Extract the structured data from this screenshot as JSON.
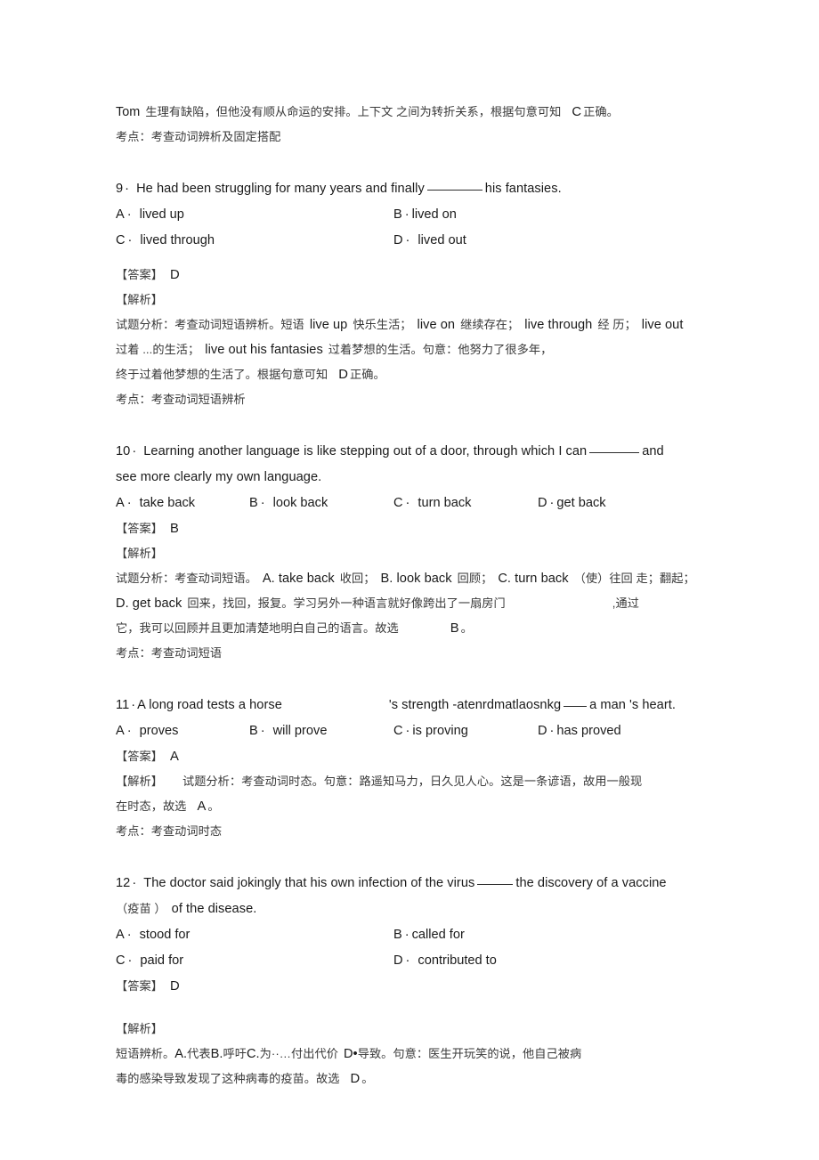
{
  "document": {
    "type": "exam-answer-key",
    "language": "zh-CN/en",
    "page_background": "#ffffff",
    "text_color": "#231f20"
  },
  "top_fragment": {
    "analysis_line": "Tom 生理有缺陷，但他没有顺从命运的安排。上下文 之间为转折关系，根据句意可知 C 正确。",
    "analysis_prefix": "Tom",
    "analysis_body_1": "生理有缺陷，但他没有顺从命运的安排。上下文 之间为转折关系，根据句意可知",
    "analysis_answer": "C",
    "analysis_body_2": "正确。",
    "point_label": "考点：考查动词辨析及固定搭配"
  },
  "questions": [
    {
      "number": "9",
      "separator": "·",
      "stem_lines": [
        "He had been struggling for many years and finally",
        "his fantasies."
      ],
      "stem_before_blank": "He had been struggling for many years and finally",
      "stem_after_blank": "his fantasies.",
      "blank_width": "long",
      "options_layout": "2-column",
      "options": [
        {
          "label": "A",
          "sep": "·",
          "text": "lived up"
        },
        {
          "label": "B",
          "sep": "·",
          "text": "lived on"
        },
        {
          "label": "C",
          "sep": "·",
          "text": "lived through"
        },
        {
          "label": "D",
          "sep": "·",
          "text": "lived out"
        }
      ],
      "answer_label": "【答案】",
      "answer": "D",
      "explain_label": "【解析】",
      "explain_lines": [
        "试题分析：考查动词短语辨析。短语 live up 快乐生活； live on 继续存在； live through 经 历； live out",
        "过着 ...的生活； live out his fantasies 过着梦想的生活。句意：他努力了很多年，",
        "终于过着他梦想的生活了。根据句意可知 D 正确。"
      ],
      "explain_seg": {
        "l1_a": "试题分析：考查动词短语辨析。短语",
        "l1_b": "live up",
        "l1_c": "快乐生活；",
        "l1_d": "live on",
        "l1_e": "继续存在；",
        "l1_f": "live through",
        "l1_g": "经 历；",
        "l1_h": "live out",
        "l2_a": "过着 ...的生活；",
        "l2_b": "live out his fantasies",
        "l2_c": "过着梦想的生活。句意：他努力了很多年，",
        "l3_a": "终于过着他梦想的生活了。根据句意可知",
        "l3_b": "D",
        "l3_c": "正确。"
      },
      "point_label": "考点：考查动词短语辨析"
    },
    {
      "number": "10",
      "separator": "·",
      "stem_before_blank": "Learning another language is like stepping out of a door, through which I can",
      "stem_after_blank": "and",
      "stem_line2": "see more clearly my own language.",
      "blank_width": "mid",
      "options_layout": "4-column",
      "options": [
        {
          "label": "A",
          "sep": "·",
          "text": "take back"
        },
        {
          "label": "B",
          "sep": "·",
          "text": "look back"
        },
        {
          "label": "C",
          "sep": "·",
          "text": "turn back"
        },
        {
          "label": "D",
          "sep": "·",
          "text": "get back"
        }
      ],
      "answer_label": "【答案】",
      "answer": "B",
      "explain_label": "【解析】",
      "explain_seg": {
        "l1_a": "试题分析：考查动词短语。",
        "l1_b": "A. take back",
        "l1_c": "收回；",
        "l1_d": "B. look back",
        "l1_e": "回顾；",
        "l1_f": "C. turn back",
        "l1_g": "（使）往回 走；翻起；",
        "l2_a": "D. get back",
        "l2_b": "回来，找回，报复。学习另外一种语言就好像跨出了一扇房门",
        "l2_c": ",通过",
        "l3_a": "它，我可以回顾并且更加清楚地明白自己的语言。故选",
        "l3_b": "B",
        "l3_c": "。"
      },
      "point_label": "考点：考查动词短语"
    },
    {
      "number": "11",
      "separator": "·",
      "stem_a": "A long road tests a horse",
      "stem_b": "'s strength -atenrdmatlaosnkg",
      "stem_c": "a man 's heart.",
      "blank_width": "tiny",
      "options_layout": "4-column",
      "options": [
        {
          "label": "A",
          "sep": "·",
          "text": "proves"
        },
        {
          "label": "B",
          "sep": "·",
          "text": "will prove"
        },
        {
          "label": "C",
          "sep": "·",
          "text": "is proving"
        },
        {
          "label": "D",
          "sep": "·",
          "text": "has proved"
        }
      ],
      "answer_label": "【答案】",
      "answer": "A",
      "explain_label": "【解析】",
      "explain_seg": {
        "l1_a": "试题分析：考查动词时态。句意：路遥知马力，日久见人心。这是一条谚语，故用一般现",
        "l2_a": "在时态，故选",
        "l2_b": "A",
        "l2_c": "。"
      },
      "point_label": "考点：考查动词时态"
    },
    {
      "number": "12",
      "separator": "·",
      "stem_before_blank": "The doctor said jokingly that his own infection of the virus",
      "stem_after_blank": "the discovery of a vaccine",
      "stem_line2_cn": "（疫苗 ）",
      "stem_line2_en": "of the disease.",
      "blank_width": "short",
      "options_layout": "2-column",
      "options": [
        {
          "label": "A",
          "sep": "·",
          "text": "stood for"
        },
        {
          "label": "B",
          "sep": "·",
          "text": "called for"
        },
        {
          "label": "C",
          "sep": "·",
          "text": "paid for"
        },
        {
          "label": "D",
          "sep": "·",
          "text": "contributed to"
        }
      ],
      "answer_label": "【答案】",
      "answer": "D",
      "explain_label": "【解析】",
      "explain_seg": {
        "l1_a": "短语辨析。",
        "l1_b": "A.",
        "l1_c": "代表",
        "l1_d": "B.",
        "l1_e": "呼吁",
        "l1_f": "C.",
        "l1_g": "为··…付出代价",
        "l1_h": "D•",
        "l1_i": "导致。句意：医生开玩笑的说，他自己被病",
        "l2_a": "毒的感染导致发现了这种病毒的疫苗。故选",
        "l2_b": "D",
        "l2_c": "。"
      }
    }
  ]
}
